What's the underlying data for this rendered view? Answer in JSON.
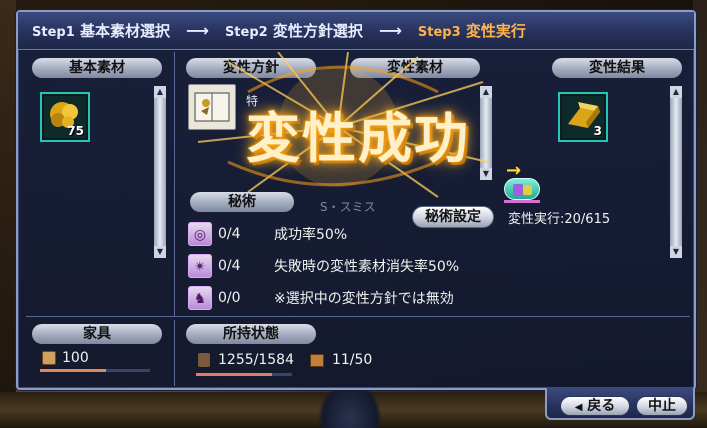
{
  "steps": {
    "step1_tag": "Step1",
    "step1_label": "基本素材選択",
    "step2_tag": "Step2",
    "step2_label": "変性方針選択",
    "step3_tag": "Step3",
    "step3_label": "変性実行",
    "arrow": "⟶"
  },
  "sections": {
    "base_material": "基本素材",
    "policy": "変性方針",
    "variant_material": "変性素材",
    "result": "変性結果",
    "secret_arts": "秘術",
    "furniture": "家具",
    "holdings": "所持状態"
  },
  "base_item": {
    "count": "75"
  },
  "result_item": {
    "count": "3"
  },
  "banner": {
    "text": "変性成功"
  },
  "secret_settings_button": "秘術設定",
  "execute_status": "変性実行:20/615",
  "overlay_name": "S・スミス",
  "skills": [
    {
      "count": "0/4",
      "desc": "成功率50%"
    },
    {
      "count": "0/4",
      "desc": "失敗時の変性素材消失率50%"
    },
    {
      "count": "0/0",
      "desc": "※選択中の変性方針では無効"
    }
  ],
  "furniture": {
    "value": "100"
  },
  "holdings": {
    "weight": "1255/1584",
    "weight_fraction": 0.79,
    "slots": "11/50"
  },
  "footer": {
    "back_label": "戻る",
    "back_icon": "◀",
    "stop_label": "中止"
  },
  "colors": {
    "active_step": "#ffb44a",
    "slot_border": "#24c6b8",
    "accent": "#8d9cc2"
  }
}
